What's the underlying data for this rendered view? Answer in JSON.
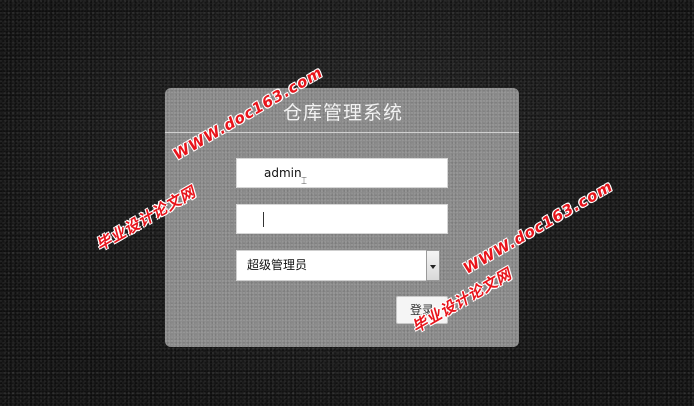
{
  "app": {
    "title": "仓库管理系统"
  },
  "form": {
    "username_value": "admin",
    "password_value": "",
    "role_selected": "超级管理员",
    "login_label": "登录"
  },
  "watermarks": {
    "url_text": "WWW.doc163.com",
    "brand_text": "毕业设计论文网"
  },
  "colors": {
    "panel": "#8a8a8a",
    "background": "#1b1b1b",
    "watermark": "#e8141b"
  },
  "icons": {
    "select_arrow": "chevron-down-icon",
    "text_cursor": "ibeam-cursor-icon"
  }
}
